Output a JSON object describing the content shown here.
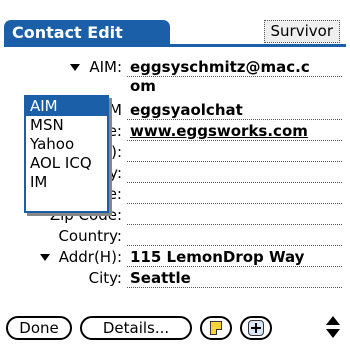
{
  "header": {
    "title": "Contact Edit",
    "category": "Survivor"
  },
  "fields": {
    "aim": {
      "label": "AIM:",
      "value_line1": "eggsyschmitz@mac.c",
      "value_line2": "om"
    },
    "im2": {
      "label_fragment": "M",
      "value": "eggsyaolchat"
    },
    "website": {
      "label_fragment": "e:",
      "value": "www.eggsworks.com"
    },
    "row4": {
      "label_fragment": "):"
    },
    "row5": {
      "label_fragment": "y:"
    },
    "row6": {
      "label_fragment": "e:"
    },
    "zip": {
      "label": "Zip Code:"
    },
    "country": {
      "label": "Country:"
    },
    "addr": {
      "label": "Addr(H):",
      "value": "115 LemonDrop Way"
    },
    "city": {
      "label": "City:",
      "value": "Seattle"
    }
  },
  "popup": {
    "items": [
      "AIM",
      "MSN",
      "Yahoo",
      "AOL ICQ",
      "IM"
    ],
    "selected": "AIM"
  },
  "buttons": {
    "done": "Done",
    "details": "Details..."
  },
  "colors": {
    "accent": "#1b5fa8",
    "note_icon": "#f5d33a"
  },
  "icons": {
    "note": "note-icon",
    "add": "plus-icon",
    "scroll": "scroll-arrows-icon"
  }
}
